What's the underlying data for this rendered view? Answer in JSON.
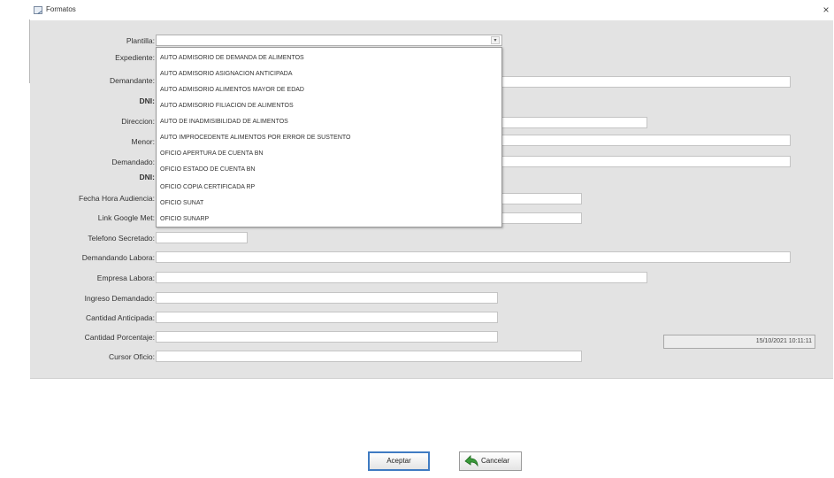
{
  "window": {
    "title": "Formatos",
    "close_glyph": "×"
  },
  "form": {
    "labels": {
      "plantilla": "Plantilla:",
      "expediente": "Expediente:",
      "demandante": "Demandante:",
      "dni1": "DNI:",
      "direccion": "Direccion:",
      "menor": "Menor:",
      "demandado": "Demandado:",
      "dni2": "DNI:",
      "fecha_audiencia": "Fecha Hora Audiencia:",
      "link_meet": "Link Google Met:",
      "telefono": "Telefono Secretado:",
      "demandado_labora": "Demandando Labora:",
      "empresa_labora": "Empresa Labora:",
      "ingreso": "Ingreso Demandado:",
      "cantidad_anticipada": "Cantidad Anticipada:",
      "cantidad_porcentaje": "Cantidad Porcentaje:",
      "cursor_oficio": "Cursor Oficio:"
    },
    "date_field_value": "15/10/2021 10:11:11"
  },
  "plantilla_dropdown": {
    "selected": "",
    "options": [
      "AUTO ADMISORIO DE DEMANDA DE ALIMENTOS",
      "AUTO ADMISORIO ASIGNACION ANTICIPADA",
      "AUTO ADMISORIO ALIMENTOS MAYOR DE EDAD",
      "AUTO ADMISORIO FILIACION DE ALIMENTOS",
      "AUTO DE INADMISIBILIDAD DE ALIMENTOS",
      "AUTO IMPROCEDENTE ALIMENTOS POR ERROR DE SUSTENTO",
      "OFICIO APERTURA DE CUENTA BN",
      "OFICIO ESTADO DE CUENTA BN",
      "OFICIO COPIA CERTIFICADA RP",
      "OFICIO SUNAT",
      "OFICIO SUNARP"
    ]
  },
  "buttons": {
    "accept": "Aceptar",
    "cancel": "Cancelar"
  },
  "icons": {
    "window": "form-window-icon",
    "cancel": "back-arrow-icon"
  }
}
